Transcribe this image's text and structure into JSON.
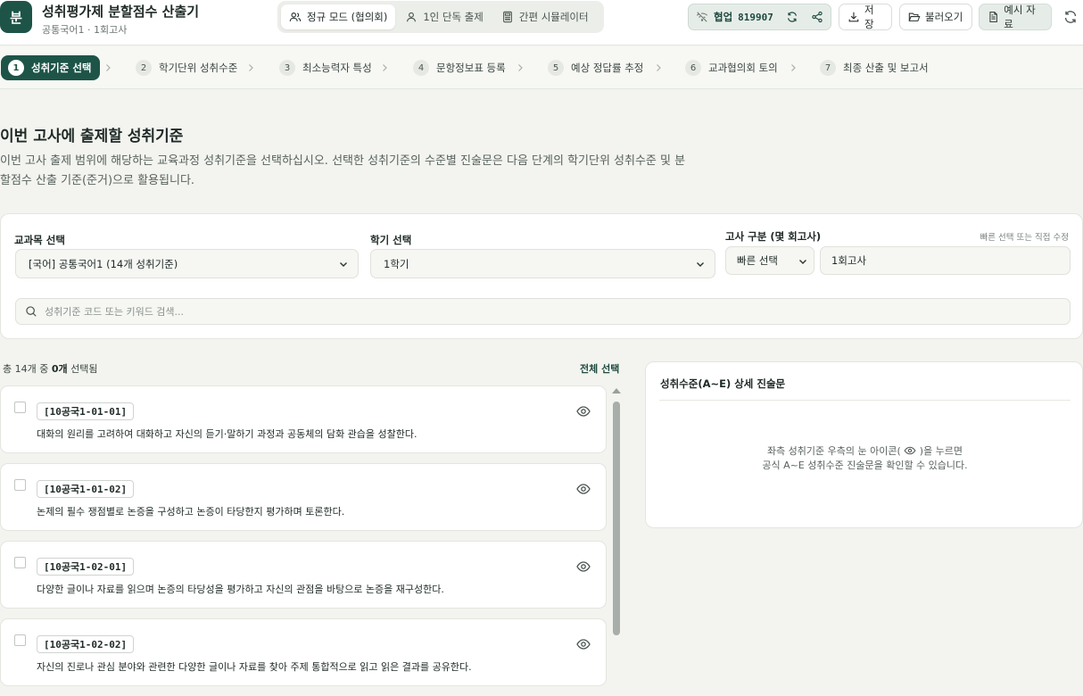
{
  "app": {
    "logo_char": "분",
    "title": "성취평가제 분할점수 산출기",
    "subtitle": "공통국어1 · 1회고사"
  },
  "modes": [
    {
      "label": "정규 모드 (협의회)",
      "icon": "users-icon",
      "active": true
    },
    {
      "label": "1인 단독 출제",
      "icon": "user-icon",
      "active": false
    },
    {
      "label": "간편 시뮬레이터",
      "icon": "calculator-icon",
      "active": false
    }
  ],
  "collab": {
    "label": "협업",
    "code": "819907"
  },
  "toolbar": {
    "save": "저장",
    "load": "불러오기",
    "sample": "예시 자료"
  },
  "steps": [
    {
      "num": "1",
      "label": "성취기준 선택"
    },
    {
      "num": "2",
      "label": "학기단위 성취수준"
    },
    {
      "num": "3",
      "label": "최소능력자 특성"
    },
    {
      "num": "4",
      "label": "문항정보표 등록"
    },
    {
      "num": "5",
      "label": "예상 정답률 추정"
    },
    {
      "num": "6",
      "label": "교과협의회 토의"
    },
    {
      "num": "7",
      "label": "최종 산출 및 보고서"
    }
  ],
  "intro": {
    "title": "이번 고사에 출제할 성취기준",
    "line1": "이번 고사 출제 범위에 해당하는 교육과정 성취기준을 선택하십시오. 선택한 성취기준의 수준별 진술문은 다음 단계의 학기단위 성취수준 및 분",
    "line2": "할점수 산출 기준(준거)으로 활용됩니다."
  },
  "filters": {
    "subject_label": "교과목 선택",
    "subject_value": "[국어] 공통국어1 (14개 성취기준)",
    "semester_label": "학기 선택",
    "semester_value": "1학기",
    "exam_label": "고사 구분 (몇 회고사)",
    "exam_hint": "빠른 선택 또는 직접 수정",
    "quick_select": "빠른 선택",
    "exam_value": "1회고사",
    "search_placeholder": "성취기준 코드 또는 키워드 검색..."
  },
  "list": {
    "count_prefix": "총 14개 중 ",
    "count_selected": "0개",
    "count_suffix": " 선택됨",
    "select_all": "전체 선택",
    "items": [
      {
        "code": "[10공국1-01-01]",
        "desc": "대화의 원리를 고려하여 대화하고 자신의 듣기·말하기 과정과 공동체의 담화 관습을 성찰한다."
      },
      {
        "code": "[10공국1-01-02]",
        "desc": "논제의 필수 쟁점별로 논증을 구성하고 논증이 타당한지 평가하며 토론한다."
      },
      {
        "code": "[10공국1-02-01]",
        "desc": "다양한 글이나 자료를 읽으며 논증의 타당성을 평가하고 자신의 관점을 바탕으로 논증을 재구성한다."
      },
      {
        "code": "[10공국1-02-02]",
        "desc": "자신의 진로나 관심 분야와 관련한 다양한 글이나 자료를 찾아 주제 통합적으로 읽고 읽은 결과를 공유한다."
      }
    ]
  },
  "panel": {
    "title": "성취수준(A~E) 상세 진술문",
    "msg_before_icon": "좌측 성취기준 우측의 눈 아이콘(",
    "msg_after_icon": ")을 누르면",
    "msg_line2": "공식 A~E 성취수준 진술문을 확인할 수 있습니다."
  },
  "colors": {
    "accent": "#1e5448",
    "background": "#f3f4ef",
    "panel": "#ffffff"
  }
}
